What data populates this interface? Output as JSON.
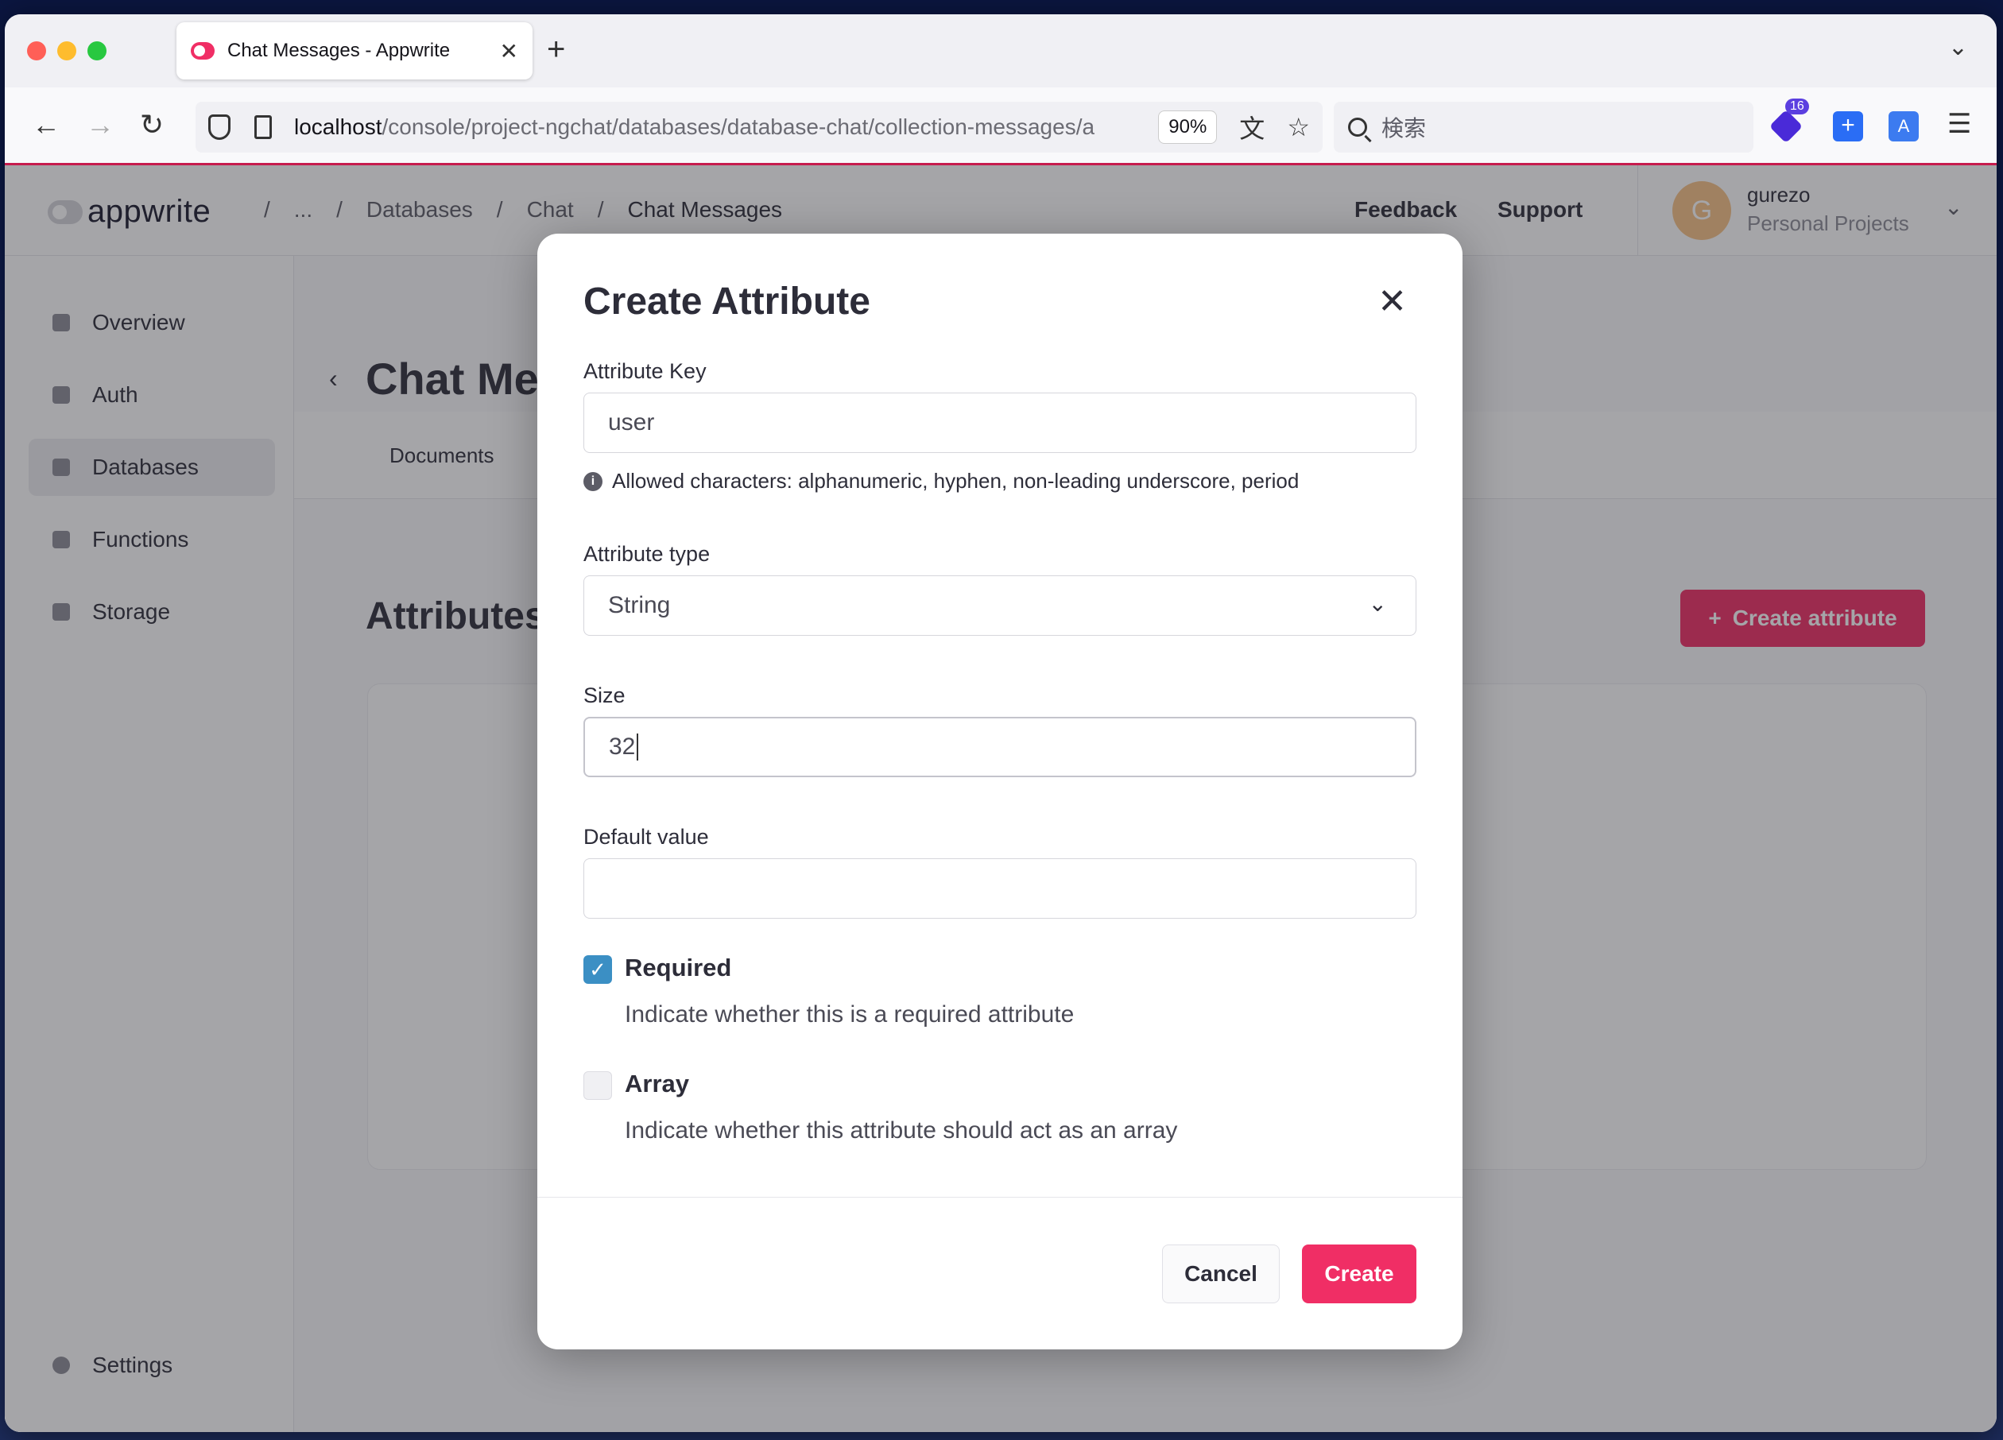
{
  "browser": {
    "tab_title": "Chat Messages - Appwrite",
    "url_host": "localhost",
    "url_path": "/console/project-ngchat/databases/database-chat/collection-messages/a",
    "zoom": "90%",
    "search_placeholder": "検索",
    "ext_badge": "16"
  },
  "header": {
    "logo_text": "appwrite",
    "breadcrumbs": [
      "...",
      "Databases",
      "Chat",
      "Chat Messages"
    ],
    "feedback": "Feedback",
    "support": "Support",
    "avatar_initial": "G",
    "user_name": "gurezo",
    "user_org": "Personal Projects"
  },
  "sidebar": {
    "items": [
      {
        "label": "Overview",
        "icon": "bar-chart-icon"
      },
      {
        "label": "Auth",
        "icon": "users-icon"
      },
      {
        "label": "Databases",
        "icon": "database-icon"
      },
      {
        "label": "Functions",
        "icon": "lightning-icon"
      },
      {
        "label": "Storage",
        "icon": "folder-icon"
      }
    ],
    "settings": "Settings"
  },
  "main": {
    "title": "Chat Me",
    "tab": "Documents",
    "section_title": "Attributes",
    "create_button": "Create attribute"
  },
  "modal": {
    "title": "Create Attribute",
    "key_label": "Attribute Key",
    "key_value": "user",
    "key_hint": "Allowed characters: alphanumeric, hyphen, non-leading underscore, period",
    "type_label": "Attribute type",
    "type_value": "String",
    "size_label": "Size",
    "size_value": "32",
    "default_label": "Default value",
    "default_value": "",
    "required_label": "Required",
    "required_desc": "Indicate whether this is a required attribute",
    "required_checked": true,
    "array_label": "Array",
    "array_desc": "Indicate whether this attribute should act as an array",
    "array_checked": false,
    "cancel": "Cancel",
    "create": "Create"
  },
  "colors": {
    "accent": "#f02e65",
    "checkbox": "#3b8fc4"
  }
}
